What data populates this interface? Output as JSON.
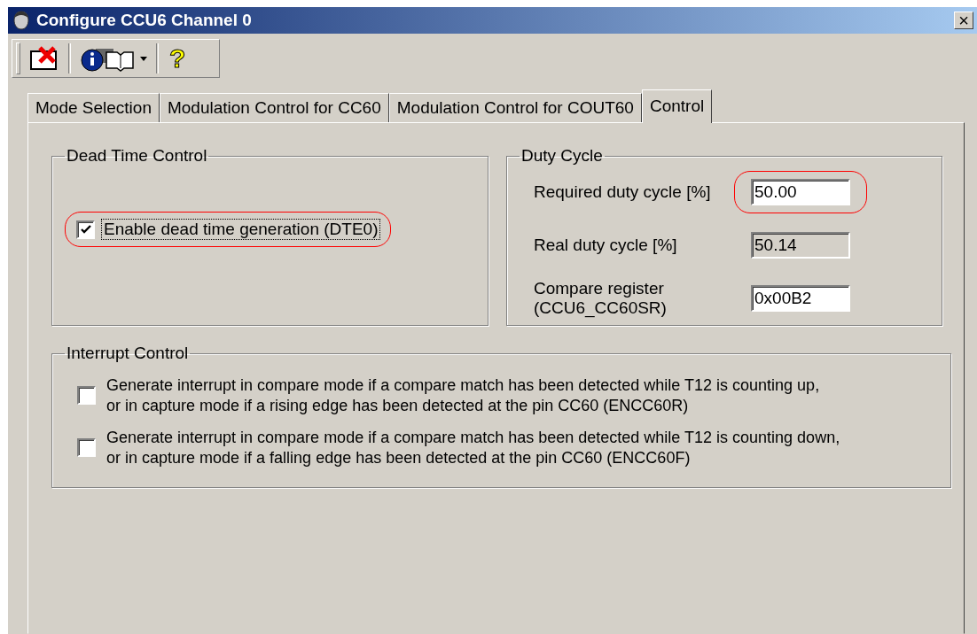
{
  "window": {
    "title": "Configure CCU6 Channel 0",
    "close": "×"
  },
  "toolbar": [
    {
      "kind": "close-window"
    },
    {
      "kind": "info-book"
    },
    {
      "kind": "help",
      "glyph": "?"
    }
  ],
  "tabs": [
    {
      "label": "Mode Selection",
      "selected": false
    },
    {
      "label": "Modulation Control for CC60",
      "selected": false
    },
    {
      "label": "Modulation Control for COUT60",
      "selected": false
    },
    {
      "label": "Control",
      "selected": true
    }
  ],
  "dead_time": {
    "title": "Dead Time Control",
    "checkbox": {
      "label": "Enable dead time generation (DTE0)",
      "checked": true,
      "highlighted": true
    }
  },
  "duty_cycle": {
    "title": "Duty Cycle",
    "fields": [
      {
        "label": "Required duty cycle [%]",
        "value": "50.00",
        "disabled": false,
        "highlighted": true
      },
      {
        "label": "Real duty cycle [%]",
        "value": "50.14",
        "disabled": true,
        "highlighted": false
      },
      {
        "label": "Compare register\n(CCU6_CC60SR)",
        "value": "0x00B2",
        "disabled": false,
        "highlighted": false
      }
    ]
  },
  "interrupt": {
    "title": "Interrupt Control",
    "options": [
      {
        "label": "Generate interrupt in compare mode if a compare match has been detected while T12 is counting up,\nor in capture mode if a rising edge has been detected at the pin CC60 (ENCC60R)",
        "checked": false
      },
      {
        "label": "Generate interrupt in compare mode if a compare match has been detected while T12 is counting down,\nor in capture mode if a falling edge has been detected at the pin CC60 (ENCC60F)",
        "checked": false
      }
    ]
  }
}
